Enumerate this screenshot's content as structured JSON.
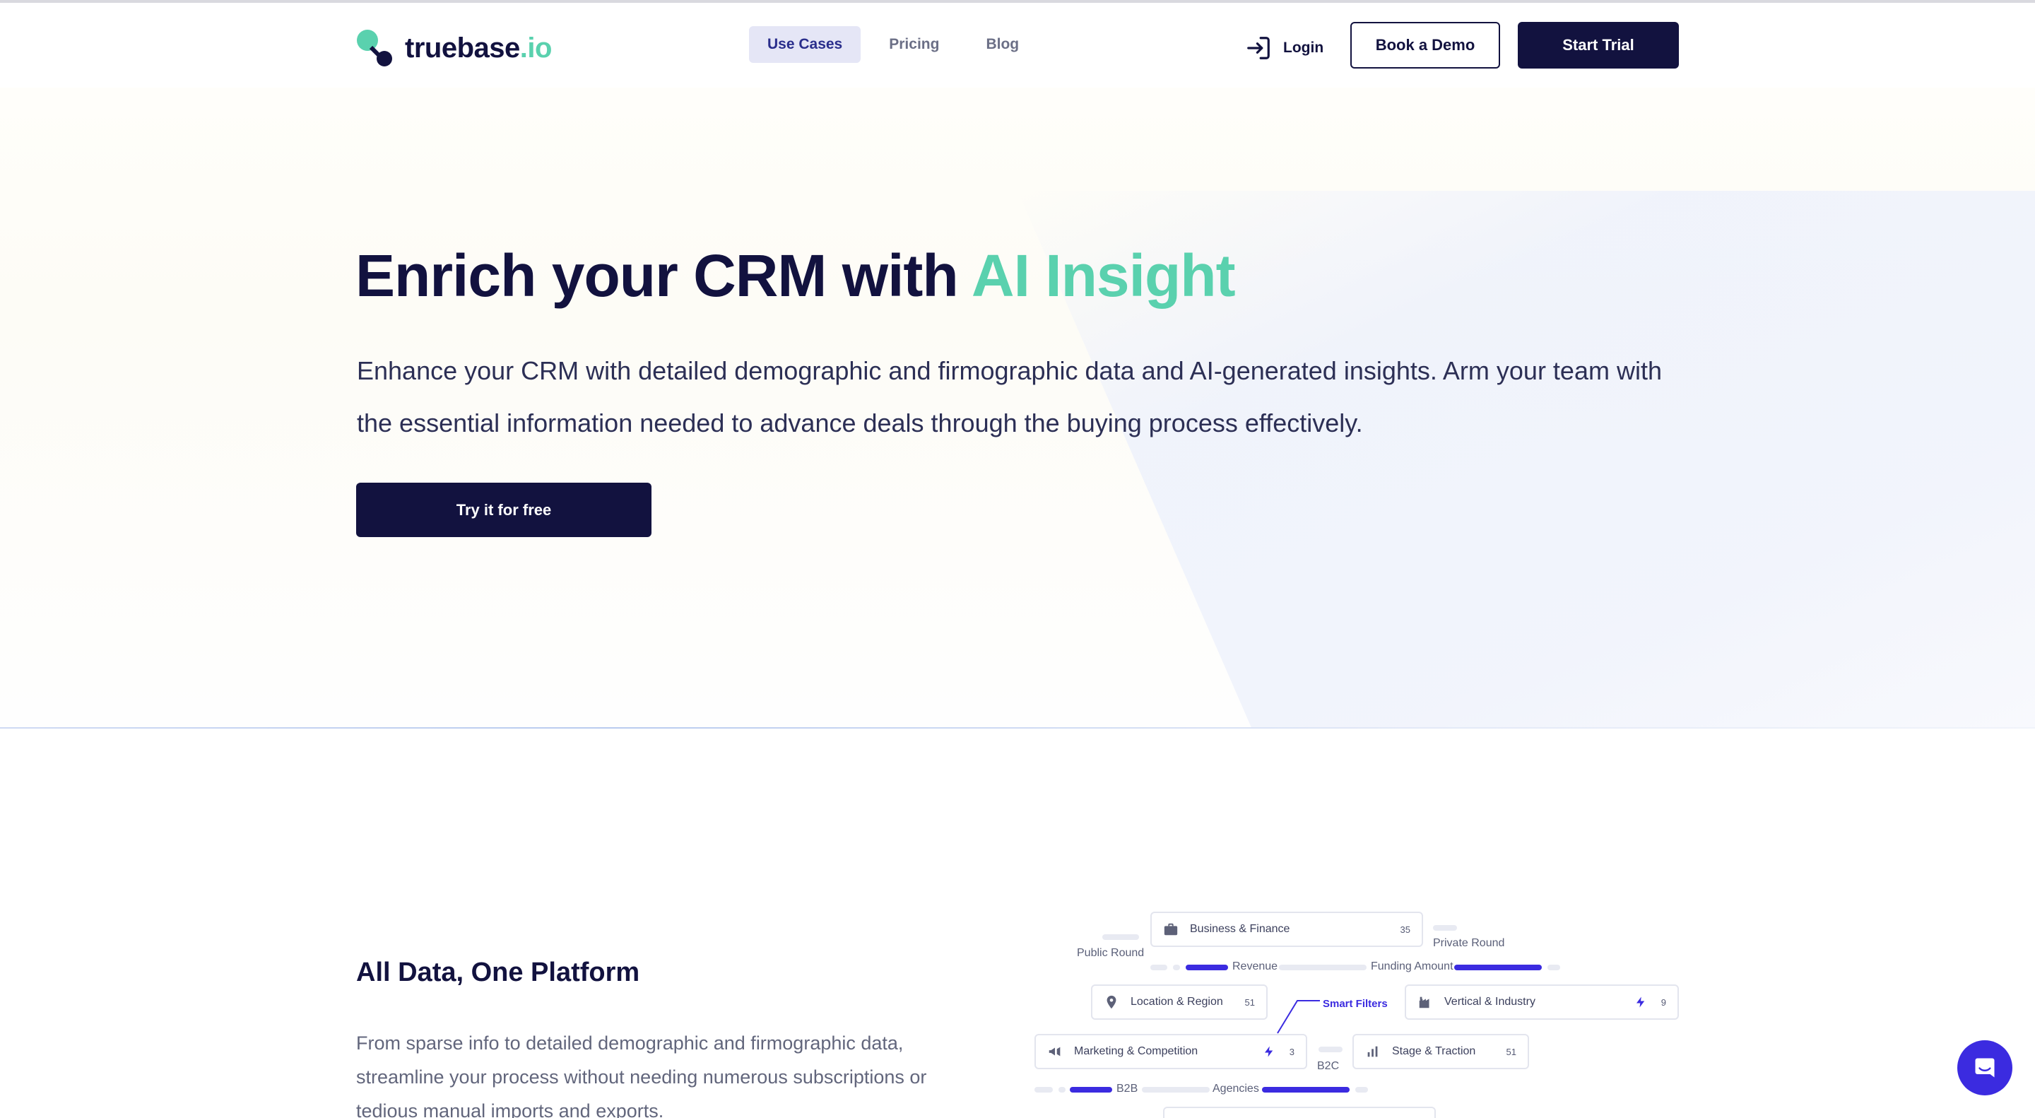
{
  "brand": {
    "name": "truebase",
    "tld": ".io"
  },
  "nav": [
    {
      "label": "Use Cases",
      "active": true
    },
    {
      "label": "Pricing",
      "active": false
    },
    {
      "label": "Blog",
      "active": false
    }
  ],
  "header": {
    "login_label": "Login",
    "demo_label": "Book a Demo",
    "trial_label": "Start Trial"
  },
  "hero": {
    "title_main": "Enrich your CRM with ",
    "title_accent": "AI Insight",
    "subtitle": "Enhance your CRM with detailed demographic and firmographic data and AI-generated insights. Arm your team with the essential information needed to advance deals through the buying process effectively.",
    "cta_label": "Try it for free"
  },
  "section": {
    "title": "All Data, One Platform",
    "body": "From sparse info to detailed demographic and firmographic data, streamline your process without needing numerous subscriptions or tedious manual imports and exports."
  },
  "illustration": {
    "cards": [
      {
        "label": "Business & Finance",
        "count": "35",
        "icon": "briefcase-icon"
      },
      {
        "label": "Location & Region",
        "count": "51",
        "icon": "location-pin-icon"
      },
      {
        "label": "Vertical & Industry",
        "count": "9",
        "icon": "factory-icon"
      },
      {
        "label": "Marketing & Competition",
        "count": "3",
        "icon": "megaphone-icon"
      },
      {
        "label": "Stage & Traction",
        "count": "51",
        "icon": "bar-chart-icon"
      }
    ],
    "labels": {
      "public_round": "Public Round",
      "private_round": "Private Round",
      "revenue": "Revenue",
      "funding_amount": "Funding Amount",
      "smart_filters": "Smart Filters",
      "b2c": "B2C",
      "b2b": "B2B",
      "agencies": "Agencies"
    }
  },
  "colors": {
    "navy": "#12123f",
    "mint": "#5ad1ae",
    "indigo": "#3b2be0"
  }
}
